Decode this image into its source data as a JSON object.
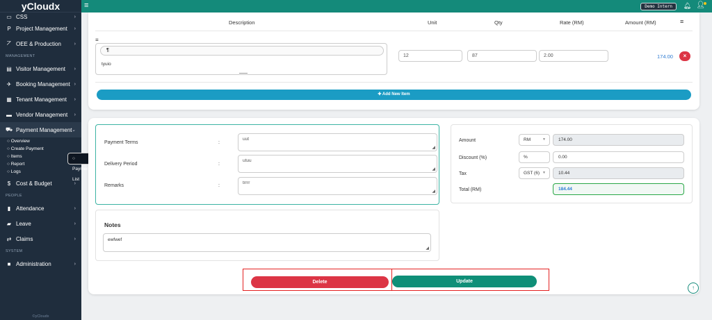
{
  "brand": "yCloudx",
  "topbar": {
    "demo_badge": "Demo Intern"
  },
  "sidebar": {
    "items": [
      {
        "label": "CSS",
        "icon": "monitor-icon"
      },
      {
        "label": "Project Management",
        "icon": "project-icon"
      },
      {
        "label": "OEE & Production",
        "icon": "chart-line-icon"
      }
    ],
    "section_management": "MANAGEMENT",
    "mgmt_items": [
      {
        "label": "Visitor Management",
        "icon": "id-card-icon"
      },
      {
        "label": "Booking Management",
        "icon": "plane-icon"
      },
      {
        "label": "Tenant Management",
        "icon": "building-icon"
      },
      {
        "label": "Vendor Management",
        "icon": "vendor-card-icon"
      },
      {
        "label": "Payment Management",
        "icon": "cart-icon"
      }
    ],
    "payment_sub": [
      "Overview",
      "Create Payment",
      "Payment List",
      "Items",
      "Report",
      "Logs"
    ],
    "cost_budget": "Cost & Budget",
    "section_people": "PEOPLE",
    "people_items": [
      {
        "label": "Attendance",
        "icon": "clipboard-icon"
      },
      {
        "label": "Leave",
        "icon": "briefcase-icon"
      },
      {
        "label": "Claims",
        "icon": "exchange-icon"
      }
    ],
    "section_system": "SYSTEM",
    "admin": "Administration",
    "footer": "©yCloudx"
  },
  "items_table": {
    "headers": {
      "description": "Description",
      "unit": "Unit",
      "qty": "Qty",
      "rate": "Rate (RM)",
      "amount": "Amount (RM)"
    },
    "row": {
      "description": "tyuio",
      "unit": "12",
      "qty": "87",
      "rate": "2.00",
      "amount": "174.00"
    },
    "add_button": "Add New Item"
  },
  "payment_info": {
    "terms_label": "Payment Terms",
    "terms_value": "uut",
    "delivery_label": "Delivery Period",
    "delivery_value": "utuu",
    "remarks_label": "Remarks",
    "remarks_value": "trrrr"
  },
  "summary": {
    "amount_label": "Amount",
    "currency": "RM",
    "amount_value": "174.00",
    "discount_label": "Discount (%)",
    "discount_unit": "%",
    "discount_value": "0.00",
    "tax_label": "Tax",
    "tax_type": "GST (6)",
    "tax_value": "10.44",
    "total_label": "Total (RM)",
    "total_value": "184.44"
  },
  "notes": {
    "title": "Notes",
    "value": "ewfwef"
  },
  "actions": {
    "delete": "Delete",
    "update": "Update"
  }
}
